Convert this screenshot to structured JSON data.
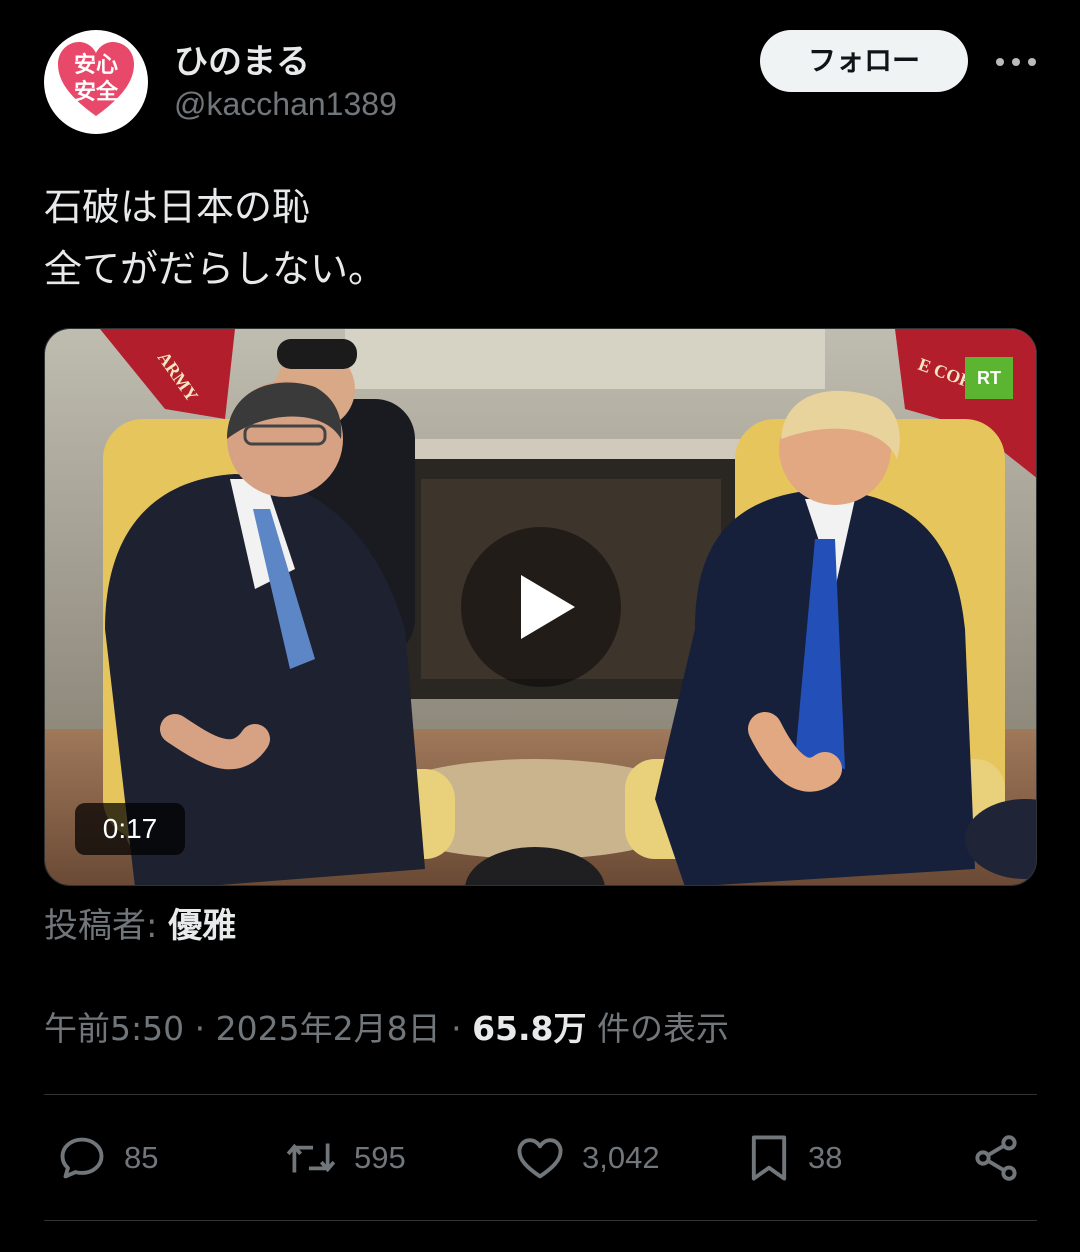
{
  "user": {
    "avatar_text_line1": "安心",
    "avatar_text_line2": "安全",
    "display_name": "ひのまる",
    "handle": "@kacchan1389"
  },
  "follow_label": "フォロー",
  "tweet": {
    "line1": "石破は日本の恥",
    "line2": "全てがだらしない。"
  },
  "media": {
    "duration": "0:17",
    "watermark": "RT",
    "flag_left_text": "ARMY",
    "flag_right_text": "E CORPS"
  },
  "poster": {
    "label": "投稿者: ",
    "name": "優雅"
  },
  "meta": {
    "time": "午前5:50",
    "sep1": " · ",
    "date": "2025年2月8日",
    "sep2": " · ",
    "views": "65.8万",
    "views_suffix": " 件の表示"
  },
  "actions": {
    "replies": "85",
    "reposts": "595",
    "likes": "3,042",
    "bookmarks": "38"
  },
  "colors": {
    "background": "#000000",
    "text_primary": "#e7e9ea",
    "text_secondary": "#71767b",
    "avatar_heart": "#e8496a",
    "rt_green": "#5cb530"
  }
}
